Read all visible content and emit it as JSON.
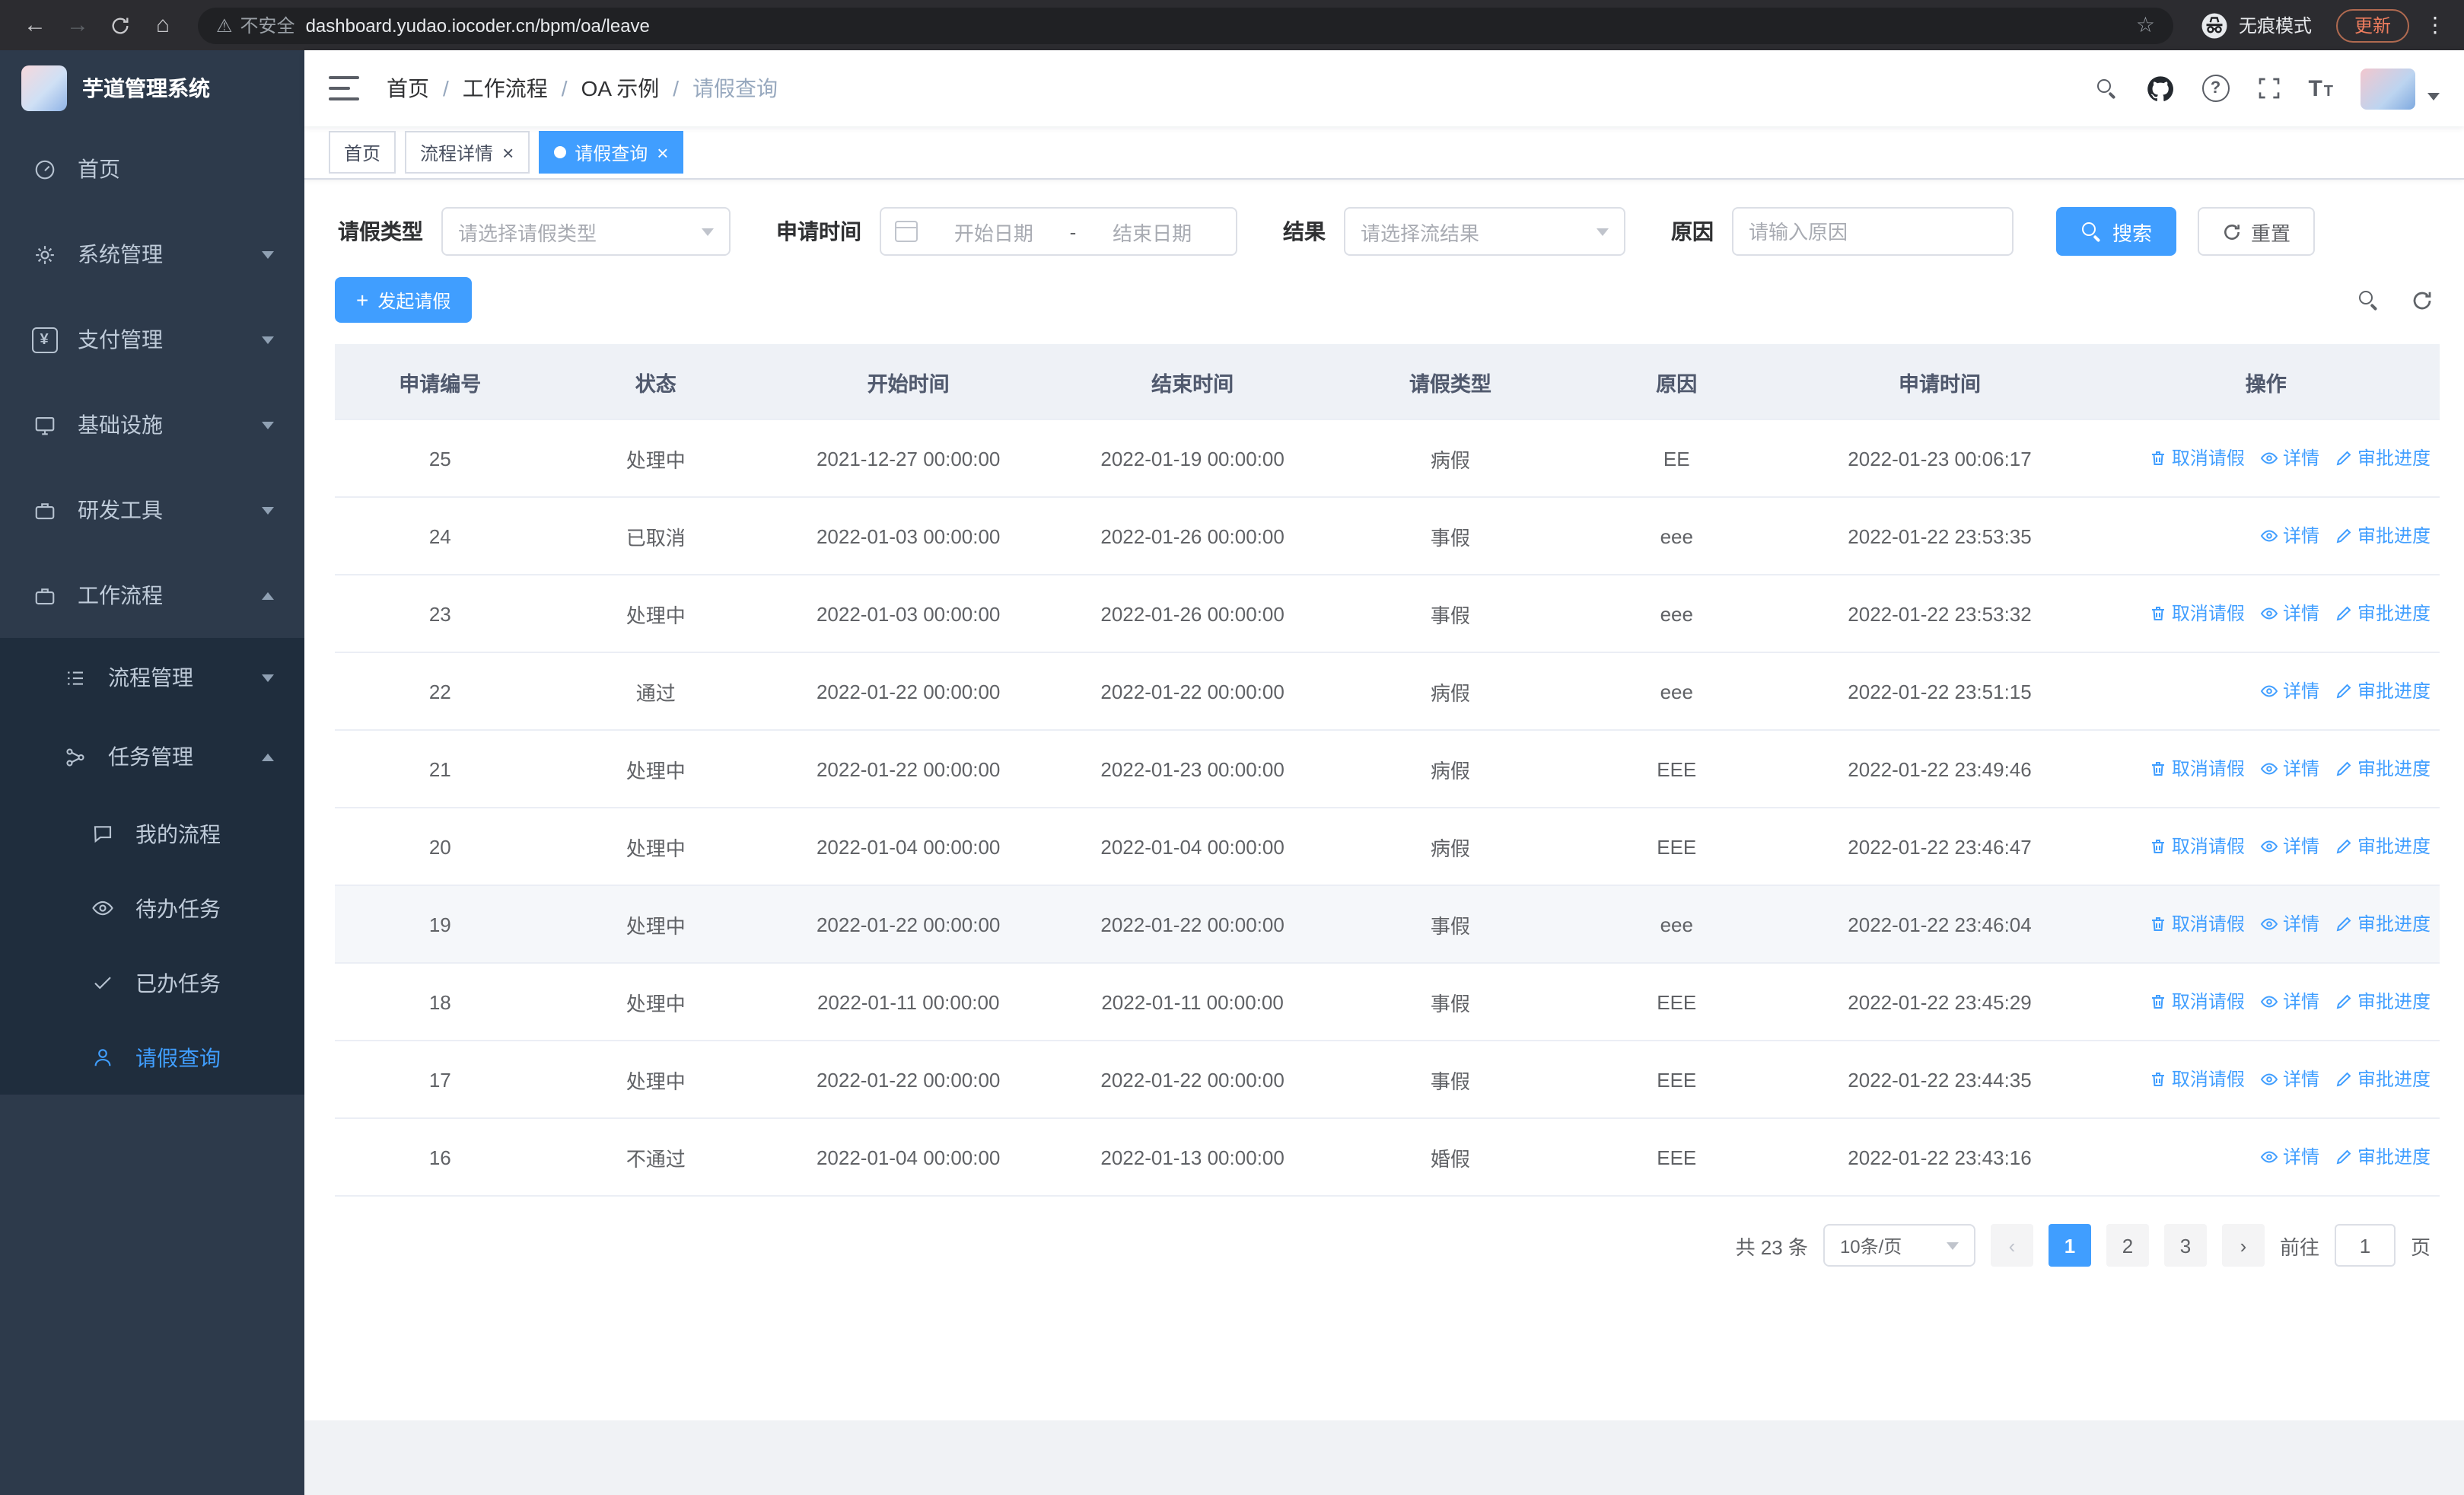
{
  "colors": {
    "primary": "#409eff",
    "sidebar_bg": "#2d3a4b",
    "submenu_bg": "#1f2d3d",
    "sidebar_active_text": "#409eff",
    "table_header_bg": "#eef1f6",
    "update_chip_text": "#ee7d5e",
    "browser_bar_bg": "#2c2c30",
    "address_bar_bg": "#202124"
  },
  "browser": {
    "security_label": "不安全",
    "url": "dashboard.yudao.iocoder.cn/bpm/oa/leave",
    "incognito_label": "无痕模式",
    "update_label": "更新"
  },
  "sidebar": {
    "app_title": "芋道管理系统",
    "items": [
      {
        "label": "首页"
      },
      {
        "label": "系统管理"
      },
      {
        "label": "支付管理"
      },
      {
        "label": "基础设施"
      },
      {
        "label": "研发工具"
      },
      {
        "label": "工作流程"
      }
    ],
    "submenu": [
      {
        "label": "流程管理"
      },
      {
        "label": "任务管理"
      }
    ],
    "leaf_items": [
      {
        "label": "我的流程"
      },
      {
        "label": "待办任务"
      },
      {
        "label": "已办任务"
      },
      {
        "label": "请假查询"
      }
    ]
  },
  "navbar": {
    "breadcrumb": [
      "首页",
      "工作流程",
      "OA 示例",
      "请假查询"
    ]
  },
  "tabs": [
    {
      "label": "首页"
    },
    {
      "label": "流程详情"
    },
    {
      "label": "请假查询"
    }
  ],
  "filters": {
    "leave_type_label": "请假类型",
    "leave_type_placeholder": "请选择请假类型",
    "apply_time_label": "申请时间",
    "start_date_placeholder": "开始日期",
    "date_separator": "-",
    "end_date_placeholder": "结束日期",
    "result_label": "结果",
    "result_placeholder": "请选择流结果",
    "reason_label": "原因",
    "reason_placeholder": "请输入原因",
    "search_label": "搜索",
    "reset_label": "重置"
  },
  "toolbar": {
    "create_label": "发起请假"
  },
  "table": {
    "columns": [
      "申请编号",
      "状态",
      "开始时间",
      "结束时间",
      "请假类型",
      "原因",
      "申请时间",
      "操作"
    ],
    "actions": {
      "cancel": "取消请假",
      "detail": "详情",
      "progress": "审批进度"
    },
    "rows": [
      {
        "id": "25",
        "status": "处理中",
        "start": "2021-12-27 00:00:00",
        "end": "2022-01-19 00:00:00",
        "type": "病假",
        "reason": "EE",
        "applied": "2022-01-23 00:06:17",
        "cancel": true,
        "hover": false
      },
      {
        "id": "24",
        "status": "已取消",
        "start": "2022-01-03 00:00:00",
        "end": "2022-01-26 00:00:00",
        "type": "事假",
        "reason": "eee",
        "applied": "2022-01-22 23:53:35",
        "cancel": false,
        "hover": false
      },
      {
        "id": "23",
        "status": "处理中",
        "start": "2022-01-03 00:00:00",
        "end": "2022-01-26 00:00:00",
        "type": "事假",
        "reason": "eee",
        "applied": "2022-01-22 23:53:32",
        "cancel": true,
        "hover": false
      },
      {
        "id": "22",
        "status": "通过",
        "start": "2022-01-22 00:00:00",
        "end": "2022-01-22 00:00:00",
        "type": "病假",
        "reason": "eee",
        "applied": "2022-01-22 23:51:15",
        "cancel": false,
        "hover": false
      },
      {
        "id": "21",
        "status": "处理中",
        "start": "2022-01-22 00:00:00",
        "end": "2022-01-23 00:00:00",
        "type": "病假",
        "reason": "EEE",
        "applied": "2022-01-22 23:49:46",
        "cancel": true,
        "hover": false
      },
      {
        "id": "20",
        "status": "处理中",
        "start": "2022-01-04 00:00:00",
        "end": "2022-01-04 00:00:00",
        "type": "病假",
        "reason": "EEE",
        "applied": "2022-01-22 23:46:47",
        "cancel": true,
        "hover": false
      },
      {
        "id": "19",
        "status": "处理中",
        "start": "2022-01-22 00:00:00",
        "end": "2022-01-22 00:00:00",
        "type": "事假",
        "reason": "eee",
        "applied": "2022-01-22 23:46:04",
        "cancel": true,
        "hover": true
      },
      {
        "id": "18",
        "status": "处理中",
        "start": "2022-01-11 00:00:00",
        "end": "2022-01-11 00:00:00",
        "type": "事假",
        "reason": "EEE",
        "applied": "2022-01-22 23:45:29",
        "cancel": true,
        "hover": false
      },
      {
        "id": "17",
        "status": "处理中",
        "start": "2022-01-22 00:00:00",
        "end": "2022-01-22 00:00:00",
        "type": "事假",
        "reason": "EEE",
        "applied": "2022-01-22 23:44:35",
        "cancel": true,
        "hover": false
      },
      {
        "id": "16",
        "status": "不通过",
        "start": "2022-01-04 00:00:00",
        "end": "2022-01-13 00:00:00",
        "type": "婚假",
        "reason": "EEE",
        "applied": "2022-01-22 23:43:16",
        "cancel": false,
        "hover": false
      }
    ]
  },
  "pagination": {
    "total_label": "共 23 条",
    "page_size": "10条/页",
    "pages": [
      "1",
      "2",
      "3"
    ],
    "active_page": "1",
    "prev_symbol": "‹",
    "next_symbol": "›",
    "goto_label": "前往",
    "goto_value": "1",
    "page_label": "页"
  }
}
